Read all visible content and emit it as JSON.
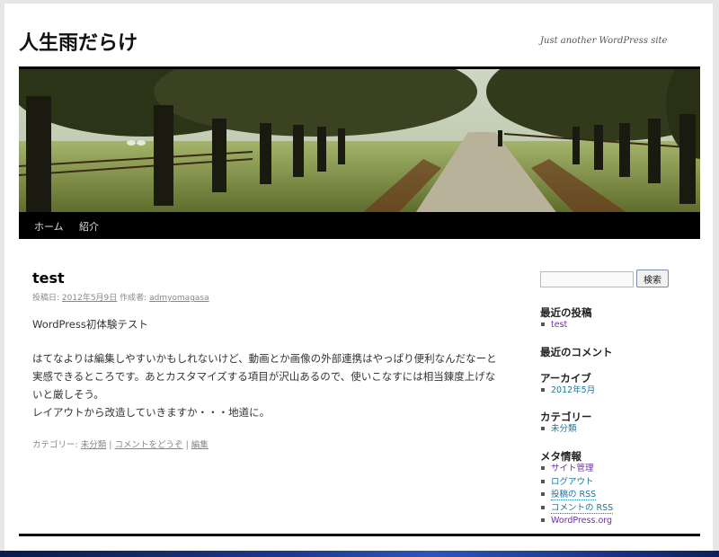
{
  "site": {
    "title": "人生雨だらけ",
    "description": "Just another WordPress site"
  },
  "nav": [
    {
      "label": "ホーム"
    },
    {
      "label": "紹介"
    }
  ],
  "post": {
    "title": "test",
    "meta": {
      "posted_label": "投稿日:",
      "date": "2012年5月9日",
      "author_label": "作成者:",
      "author": "admyomagasa"
    },
    "body": [
      "WordPress初体験テスト",
      "はてなよりは編集しやすいかもしれないけど、動画とか画像の外部連携はやっぱり便利なんだなーと実感できるところです。あとカスタマイズする項目が沢山あるので、使いこなすには相当錬度上げないと厳しそう。",
      "レイアウトから改造していきますか・・・地道に。"
    ],
    "footer": {
      "category_label": "カテゴリー:",
      "category": "未分類",
      "sep1": "|",
      "comment_link": "コメントをどうぞ",
      "sep2": "|",
      "edit_link": "編集"
    }
  },
  "sidebar": {
    "search": {
      "placeholder": "",
      "button": "検索"
    },
    "recent_posts": {
      "title": "最近の投稿",
      "items": [
        "test"
      ]
    },
    "recent_comments": {
      "title": "最近のコメント"
    },
    "archives": {
      "title": "アーカイブ",
      "items": [
        "2012年5月"
      ]
    },
    "categories": {
      "title": "カテゴリー",
      "items": [
        "未分類"
      ]
    },
    "meta": {
      "title": "メタ情報",
      "items": [
        "サイト管理",
        "ログアウト",
        "投稿の RSS",
        "コメントの RSS",
        "WordPress.org"
      ]
    }
  },
  "colors": {
    "link": "#21759b",
    "visited": "#6b2fa8",
    "nav_bg": "#000000"
  }
}
